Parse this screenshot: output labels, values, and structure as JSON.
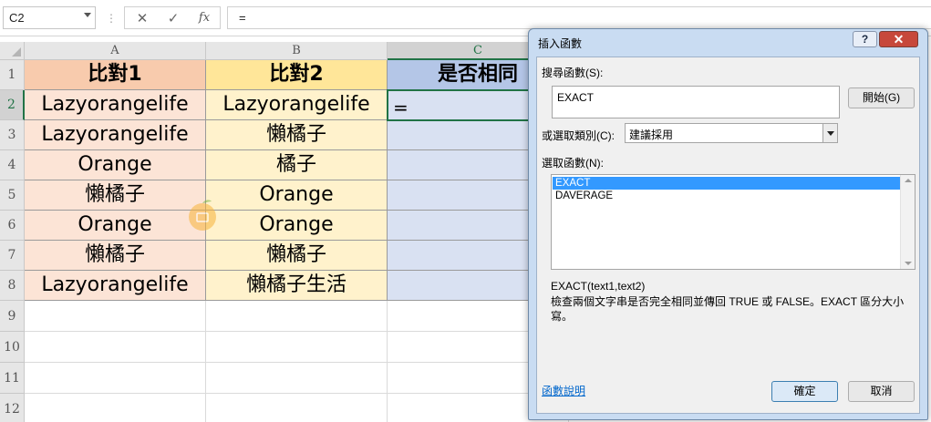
{
  "formula_bar": {
    "name_box": "C2",
    "separator": "⋮",
    "cancel_icon": "✕",
    "enter_icon": "✓",
    "fx_icon": "fx",
    "formula": "="
  },
  "sheet": {
    "columns": [
      "A",
      "B",
      "C"
    ],
    "rows": [
      "1",
      "2",
      "3",
      "4",
      "5",
      "6",
      "7",
      "8",
      "9",
      "10",
      "11",
      "12"
    ],
    "headers": {
      "col_a": "比對1",
      "col_b": "比對2",
      "col_c": "是否相同"
    },
    "data": [
      {
        "a": "Lazyorangelife",
        "b": "Lazyorangelife",
        "c": "="
      },
      {
        "a": "Lazyorangelife",
        "b": "懶橘子",
        "c": ""
      },
      {
        "a": "Orange",
        "b": "橘子",
        "c": ""
      },
      {
        "a": "懶橘子",
        "b": "Orange",
        "c": ""
      },
      {
        "a": "Orange",
        "b": "Orange",
        "c": ""
      },
      {
        "a": "懶橘子",
        "b": "懶橘子",
        "c": ""
      },
      {
        "a": "Lazyorangelife",
        "b": "懶橘子生活",
        "c": ""
      }
    ],
    "colors": {
      "col_a_header": "#f8cbad",
      "col_a_fill": "#fce4d6",
      "col_b_header": "#ffe699",
      "col_b_fill": "#fff2cc",
      "col_c_header": "#b4c6e7",
      "col_c_fill": "#d9e1f2"
    }
  },
  "dialog": {
    "title": "插入函數",
    "help_btn": "?",
    "close_btn": "✕",
    "search_label": "搜尋函數(S):",
    "search_value": "EXACT",
    "go_button": "開始(G)",
    "category_label": "或選取類別(C):",
    "category_value": "建議採用",
    "select_label": "選取函數(N):",
    "functions": [
      "EXACT",
      "DAVERAGE"
    ],
    "selected_function": "EXACT",
    "syntax": "EXACT(text1,text2)",
    "description": "檢查兩個文字串是否完全相同並傳回 TRUE 或 FALSE。EXACT 區分大小寫。",
    "help_link": "函數說明",
    "ok_button": "確定",
    "cancel_button": "取消"
  }
}
